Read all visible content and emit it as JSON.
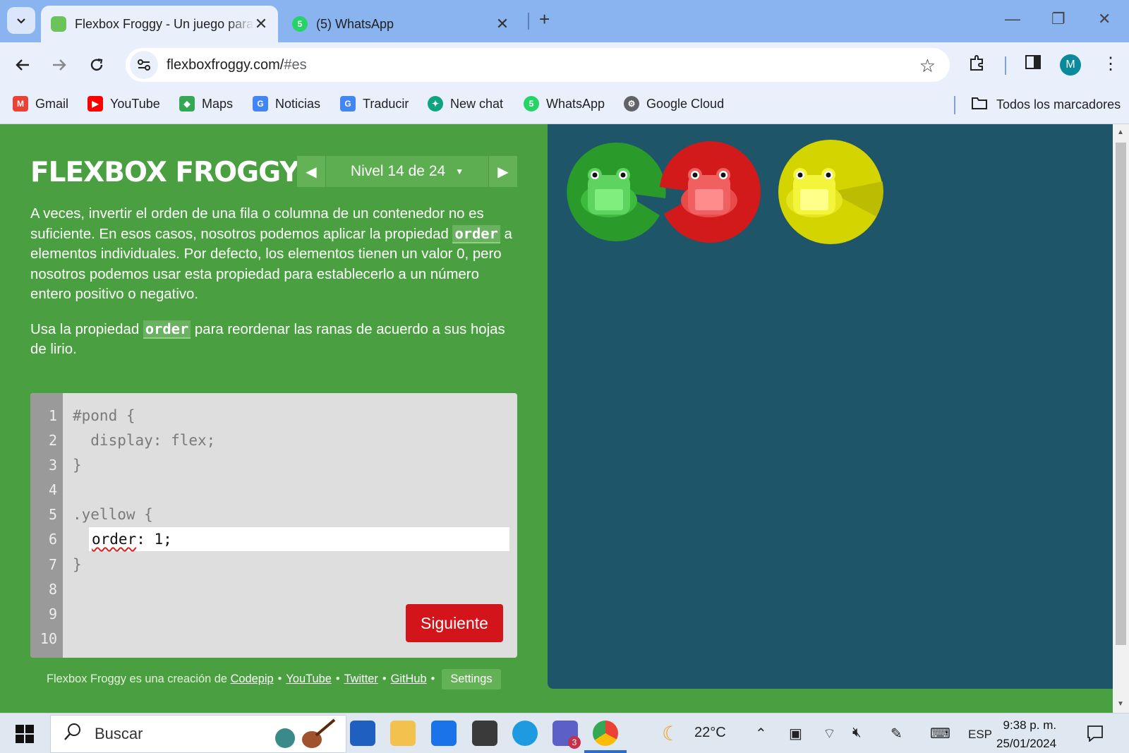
{
  "browser": {
    "tabs": [
      {
        "title": "Flexbox Froggy - Un juego para",
        "active": true,
        "icon": "frog-favicon"
      },
      {
        "title": "(5) WhatsApp",
        "active": false,
        "icon": "whatsapp-favicon",
        "badge": "5"
      }
    ],
    "url_host": "flexboxfroggy.com/",
    "url_hash": "#es",
    "avatar_letter": "M",
    "bookmarks": [
      {
        "label": "Gmail",
        "icon": "gmail-icon",
        "color": "#ea4335"
      },
      {
        "label": "YouTube",
        "icon": "youtube-icon",
        "color": "#ff0000"
      },
      {
        "label": "Maps",
        "icon": "maps-icon",
        "color": "#34a853"
      },
      {
        "label": "Noticias",
        "icon": "news-icon",
        "color": "#4285f4"
      },
      {
        "label": "Traducir",
        "icon": "translate-icon",
        "color": "#4285f4"
      },
      {
        "label": "New chat",
        "icon": "chatgpt-icon",
        "color": "#10a37f"
      },
      {
        "label": "WhatsApp",
        "icon": "whatsapp-icon",
        "color": "#25d366"
      },
      {
        "label": "Google Cloud",
        "icon": "cloud-icon",
        "color": "#5f6368"
      }
    ],
    "all_bookmarks": "Todos los marcadores"
  },
  "game": {
    "logo": "FLEXBOX FROGGY",
    "level_label": "Nivel 14 de 24",
    "instructions": {
      "p1_a": "A veces, invertir el orden de una fila o columna de un contenedor no es suficiente. En esos casos, nosotros podemos aplicar la propiedad ",
      "p1_kw": "order",
      "p1_b": " a elementos individuales. Por defecto, los elementos tienen un valor 0, pero nosotros podemos usar esta propiedad para establecerlo a un número entero positivo o negativo.",
      "p2_a": "Usa la propiedad ",
      "p2_kw": "order",
      "p2_b": " para reordenar las ranas de acuerdo a sus hojas de lirio."
    },
    "line_numbers": [
      "1",
      "2",
      "3",
      "4",
      "5",
      "6",
      "7",
      "8",
      "9",
      "10"
    ],
    "code_lines": [
      "#pond {",
      "  display: flex;",
      "}",
      "",
      ".yellow {",
      "",
      "}"
    ],
    "input_value_word": "order",
    "input_value_rest": ": 1;",
    "next_button": "Siguiente",
    "footer": {
      "prefix": "Flexbox Froggy es una creación de",
      "links": [
        "Codepip",
        "YouTube",
        "Twitter",
        "GitHub"
      ],
      "settings": "Settings"
    },
    "colors": {
      "green_bg": "#4aa040",
      "pond_bg": "#1f5569",
      "next_button": "#d3141a"
    },
    "frogs": [
      {
        "color": "green",
        "pad": "#2a9b2a",
        "body": "#5fd35f"
      },
      {
        "color": "red",
        "pad": "#d21a1a",
        "body": "#f06060"
      },
      {
        "color": "yellow",
        "pad": "#d4d400",
        "body": "#f4f43a"
      }
    ]
  },
  "taskbar": {
    "search_placeholder": "Buscar",
    "weather": "22°C",
    "language": "ESP",
    "time": "9:38 p. m.",
    "date": "25/01/2024",
    "teams_badge": "3"
  }
}
